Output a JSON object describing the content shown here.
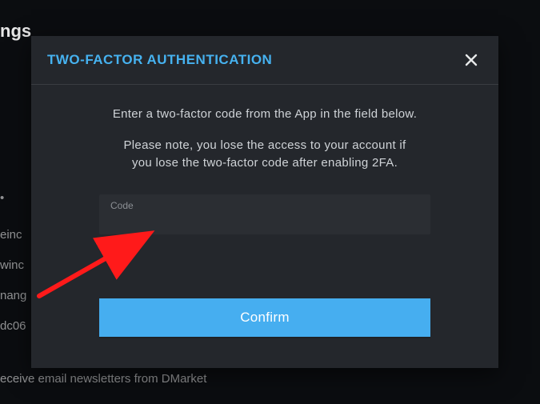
{
  "background": {
    "heading_fragment": "ngs",
    "items": [
      "einc",
      "winc",
      "nang",
      "dc06",
      "eceive email newsletters from DMarket"
    ]
  },
  "modal": {
    "title": "TWO-FACTOR AUTHENTICATION",
    "instruction_line1": "Enter a two-factor code from the App in the field below.",
    "instruction_line2a": "Please note, you lose the access to your account if",
    "instruction_line2b": "you lose the two-factor code after enabling 2FA.",
    "code_label": "Code",
    "code_value": "",
    "confirm_label": "Confirm"
  }
}
